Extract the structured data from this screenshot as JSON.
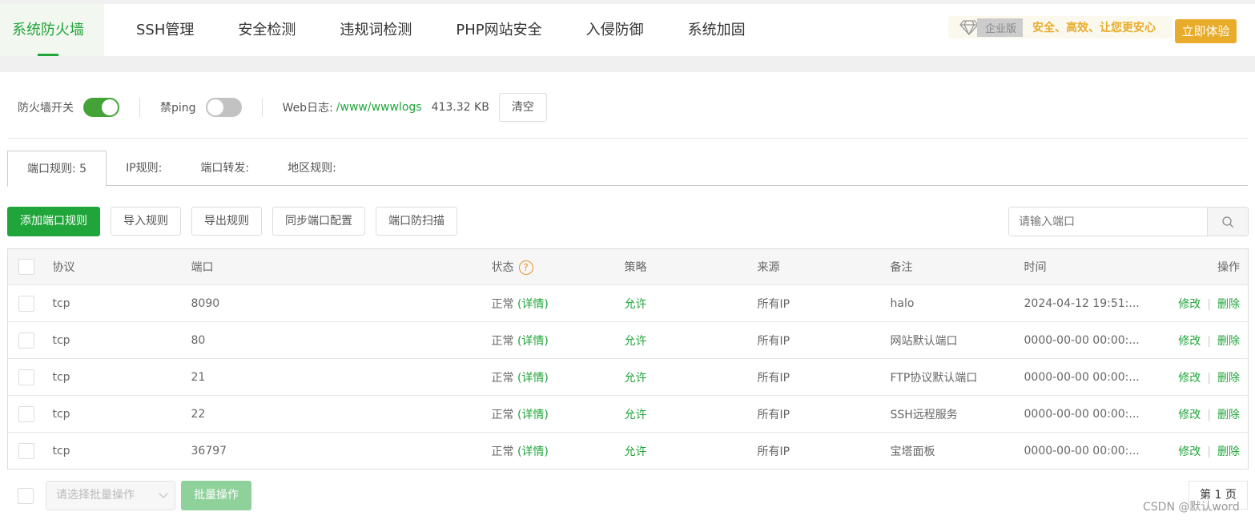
{
  "nav": {
    "items": [
      "系统防火墙",
      "SSH管理",
      "安全检测",
      "违规词检测",
      "PHP网站安全",
      "入侵防御",
      "系统加固"
    ]
  },
  "promo": {
    "edition": "企业版",
    "slogan": "安全、高效、让您更安心",
    "try_label": "立即体验"
  },
  "controls": {
    "firewall_label": "防火墙开关",
    "firewall_on": true,
    "ping_label": "禁ping",
    "ping_on": false,
    "weblog_label": "Web日志:",
    "weblog_path": "/www/wwwlogs",
    "weblog_size": "413.32 KB",
    "clear_label": "清空"
  },
  "tabs": [
    "端口规则: 5",
    "IP规则:",
    "端口转发:",
    "地区规则:"
  ],
  "toolbar": {
    "add": "添加端口规则",
    "import": "导入规则",
    "export": "导出规则",
    "sync": "同步端口配置",
    "scan": "端口防扫描",
    "search_placeholder": "请输入端口"
  },
  "table": {
    "headers": [
      "协议",
      "端口",
      "状态",
      "策略",
      "来源",
      "备注",
      "时间",
      "操作"
    ],
    "rows": [
      {
        "protocol": "tcp",
        "port": "8090",
        "status": "正常",
        "detail": "(详情)",
        "policy": "允许",
        "source": "所有IP",
        "note": "halo",
        "time": "2024-04-12 19:51:..."
      },
      {
        "protocol": "tcp",
        "port": "80",
        "status": "正常",
        "detail": "(详情)",
        "policy": "允许",
        "source": "所有IP",
        "note": "网站默认端口",
        "time": "0000-00-00 00:00:..."
      },
      {
        "protocol": "tcp",
        "port": "21",
        "status": "正常",
        "detail": "(详情)",
        "policy": "允许",
        "source": "所有IP",
        "note": "FTP协议默认端口",
        "time": "0000-00-00 00:00:..."
      },
      {
        "protocol": "tcp",
        "port": "22",
        "status": "正常",
        "detail": "(详情)",
        "policy": "允许",
        "source": "所有IP",
        "note": "SSH远程服务",
        "time": "0000-00-00 00:00:..."
      },
      {
        "protocol": "tcp",
        "port": "36797",
        "status": "正常",
        "detail": "(详情)",
        "policy": "允许",
        "source": "所有IP",
        "note": "宝塔面板",
        "time": "0000-00-00 00:00:..."
      }
    ],
    "edit": "修改",
    "delete": "删除"
  },
  "footer": {
    "batch_placeholder": "请选择批量操作",
    "batch_label": "批量操作",
    "page": "第 1 页"
  },
  "watermark": "CSDN @默认word"
}
